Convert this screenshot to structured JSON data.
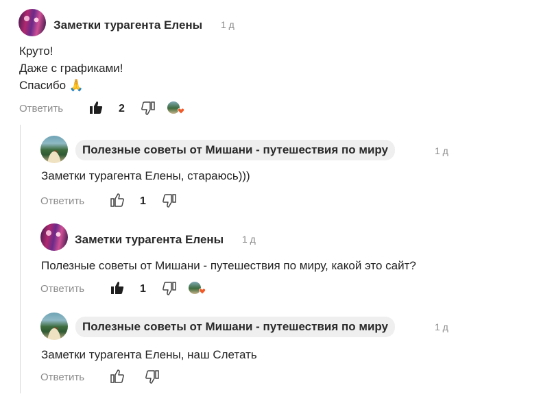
{
  "comments": [
    {
      "author": "Заметки турагента Елены",
      "time": "1 д",
      "lines": [
        "Круто!",
        "Даже с графиками!",
        "Спасибо 🙏"
      ],
      "reply_label": "Ответить",
      "likes": "2"
    },
    {
      "author": "Полезные советы от Мишани - путешествия по миру",
      "time": "1 д",
      "text": "Заметки турагента Елены, стараюсь)))",
      "reply_label": "Ответить",
      "likes": "1"
    },
    {
      "author": "Заметки турагента Елены",
      "time": "1 д",
      "text": "Полезные советы от Мишани - путешествия по миру, какой это сайт?",
      "reply_label": "Ответить",
      "likes": "1"
    },
    {
      "author": "Полезные советы от Мишани - путешествия по миру",
      "time": "1 д",
      "text": "Заметки турагента Елены, наш Слетать",
      "reply_label": "Ответить"
    }
  ],
  "icons": {
    "like_filled": "thumbs-up-filled-icon",
    "like_outline": "thumbs-up-outline-icon",
    "dislike": "thumbs-down-outline-icon",
    "author_heart": "author-heart-badge"
  },
  "colors": {
    "heart": "#f05a28",
    "muted": "#8a8a8a",
    "pill": "#efefef"
  }
}
